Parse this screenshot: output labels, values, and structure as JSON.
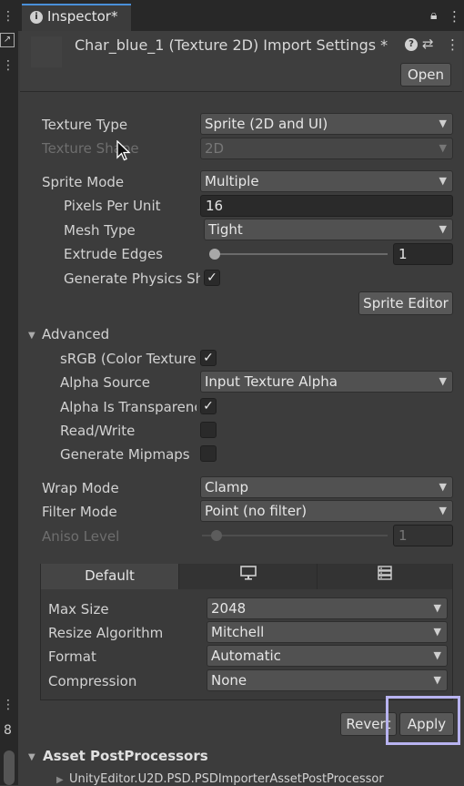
{
  "tab": {
    "title": "Inspector*"
  },
  "header": {
    "title": "Char_blue_1 (Texture 2D) Import Settings *",
    "open_label": "Open"
  },
  "settings": {
    "texture_type": {
      "label": "Texture Type",
      "value": "Sprite (2D and UI)"
    },
    "texture_shape": {
      "label": "Texture Shape",
      "value": "2D"
    },
    "sprite_mode": {
      "label": "Sprite Mode",
      "value": "Multiple"
    },
    "pixels_per_unit": {
      "label": "Pixels Per Unit",
      "value": "16"
    },
    "mesh_type": {
      "label": "Mesh Type",
      "value": "Tight"
    },
    "extrude_edges": {
      "label": "Extrude Edges",
      "value": "1",
      "fraction": 0.02
    },
    "generate_physics": {
      "label": "Generate Physics Shape",
      "checked": true
    },
    "sprite_editor_label": "Sprite Editor"
  },
  "advanced": {
    "label": "Advanced",
    "srgb": {
      "label": "sRGB (Color Texture)",
      "checked": true
    },
    "alpha_source": {
      "label": "Alpha Source",
      "value": "Input Texture Alpha"
    },
    "alpha_transparency": {
      "label": "Alpha Is Transparency",
      "checked": true
    },
    "read_write": {
      "label": "Read/Write",
      "checked": false
    },
    "mipmaps": {
      "label": "Generate Mipmaps",
      "checked": false
    }
  },
  "wrap_mode": {
    "label": "Wrap Mode",
    "value": "Clamp"
  },
  "filter_mode": {
    "label": "Filter Mode",
    "value": "Point (no filter)"
  },
  "aniso": {
    "label": "Aniso Level",
    "value": "1"
  },
  "platform": {
    "tabs": [
      "Default",
      "desktop-icon",
      "server-icon"
    ],
    "max_size": {
      "label": "Max Size",
      "value": "2048"
    },
    "resize": {
      "label": "Resize Algorithm",
      "value": "Mitchell"
    },
    "format": {
      "label": "Format",
      "value": "Automatic"
    },
    "compression": {
      "label": "Compression",
      "value": "None"
    }
  },
  "actions": {
    "revert_label": "Revert",
    "apply_label": "Apply"
  },
  "postprocessors": {
    "label": "Asset PostProcessors",
    "item": "UnityEditor.U2D.PSD.PSDImporterAssetPostProcessor"
  },
  "left_strip": {
    "value": "8"
  }
}
